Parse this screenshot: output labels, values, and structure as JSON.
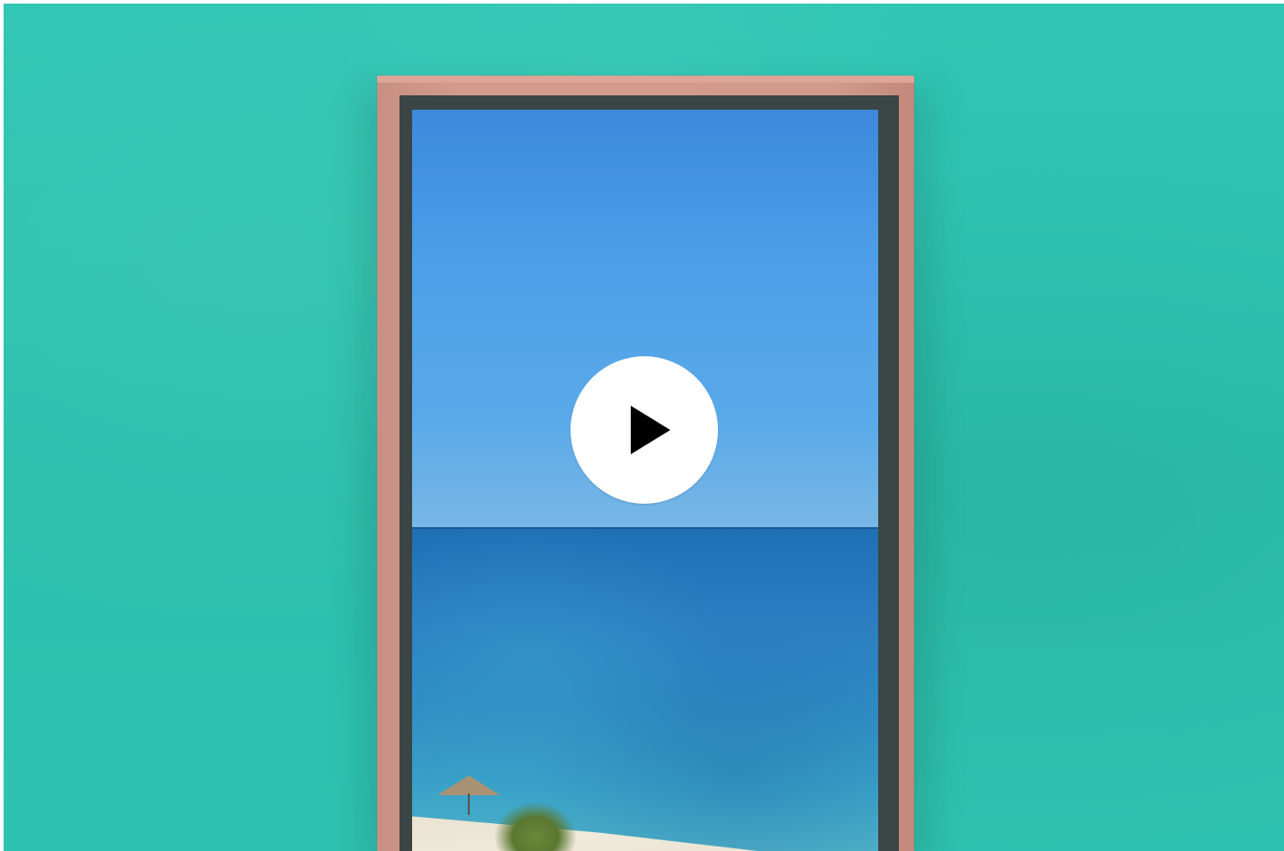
{
  "video": {
    "controls": {
      "play_icon": "play-icon"
    }
  },
  "colors": {
    "wall": "#2ec4b0",
    "frame": "#d29a8d",
    "bezel": "#3b4546",
    "play_button": "#ffffff",
    "play_icon": "#000000"
  }
}
